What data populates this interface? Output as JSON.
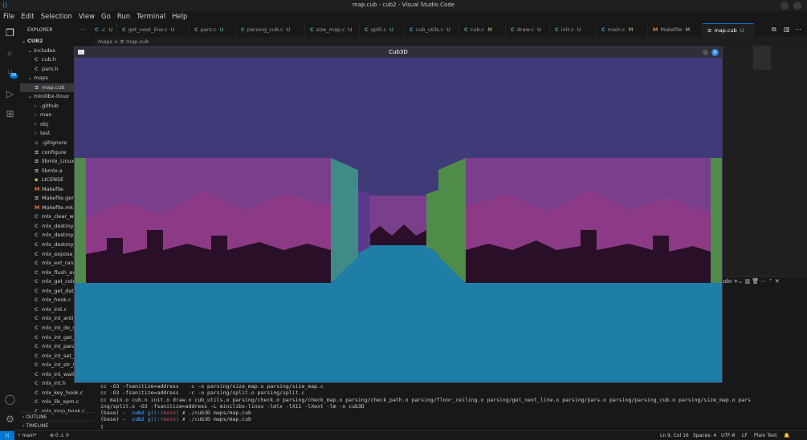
{
  "window": {
    "title": "map.cub - cub2 - Visual Studio Code"
  },
  "menu": [
    "File",
    "Edit",
    "Selection",
    "View",
    "Go",
    "Run",
    "Terminal",
    "Help"
  ],
  "activity_bar": {
    "scm_badge": "30"
  },
  "explorer": {
    "header": "EXPLORER",
    "more": "···",
    "root": "CUB2",
    "tree": [
      {
        "label": "includes",
        "type": "folder",
        "open": true,
        "depth": 1
      },
      {
        "label": "cub.h",
        "type": "c",
        "depth": 2
      },
      {
        "label": "pars.h",
        "type": "c",
        "depth": 2
      },
      {
        "label": "maps",
        "type": "folder",
        "open": true,
        "depth": 1
      },
      {
        "label": "map.cub",
        "type": "file",
        "depth": 2,
        "selected": true
      },
      {
        "label": "minilibx-linux",
        "type": "folder",
        "open": true,
        "depth": 1
      },
      {
        "label": ".github",
        "type": "folder",
        "open": false,
        "depth": 2
      },
      {
        "label": "man",
        "type": "folder",
        "open": false,
        "depth": 2
      },
      {
        "label": "obj",
        "type": "folder",
        "open": false,
        "depth": 2
      },
      {
        "label": "test",
        "type": "folder",
        "open": false,
        "depth": 2
      },
      {
        "label": ".gitignore",
        "type": "git",
        "depth": 2
      },
      {
        "label": "configure",
        "type": "file",
        "depth": 2
      },
      {
        "label": "libmlx_Linux.a",
        "type": "file",
        "depth": 2
      },
      {
        "label": "libmlx.a",
        "type": "file",
        "depth": 2
      },
      {
        "label": "LICENSE",
        "type": "license",
        "depth": 2
      },
      {
        "label": "Makefile",
        "type": "make",
        "depth": 2
      },
      {
        "label": "Makefile.gen",
        "type": "file",
        "depth": 2
      },
      {
        "label": "Makefile.mk",
        "type": "make",
        "depth": 2
      },
      {
        "label": "mlx_clear_win",
        "type": "c",
        "depth": 2
      },
      {
        "label": "mlx_destroy_c",
        "type": "c",
        "depth": 2
      },
      {
        "label": "mlx_destroy_i",
        "type": "c",
        "depth": 2
      },
      {
        "label": "mlx_destroy_v",
        "type": "c",
        "depth": 2
      },
      {
        "label": "mlx_expose_h",
        "type": "c",
        "depth": 2
      },
      {
        "label": "mlx_ext_randr",
        "type": "c",
        "depth": 2
      },
      {
        "label": "mlx_flush_eve",
        "type": "c",
        "depth": 2
      },
      {
        "label": "mlx_get_color",
        "type": "c",
        "depth": 2
      },
      {
        "label": "mlx_get_data_",
        "type": "c",
        "depth": 2
      },
      {
        "label": "mlx_hook.c",
        "type": "c",
        "depth": 2
      },
      {
        "label": "mlx_init.c",
        "type": "c",
        "depth": 2
      },
      {
        "label": "mlx_int_anti_r",
        "type": "c",
        "depth": 2
      },
      {
        "label": "mlx_int_do_nc",
        "type": "c",
        "depth": 2
      },
      {
        "label": "mlx_int_get_vi",
        "type": "c",
        "depth": 2
      },
      {
        "label": "mlx_int_param",
        "type": "c",
        "depth": 2
      },
      {
        "label": "mlx_int_set_w",
        "type": "c",
        "depth": 2
      },
      {
        "label": "mlx_int_str_to",
        "type": "c",
        "depth": 2
      },
      {
        "label": "mlx_int_wait_f",
        "type": "c",
        "depth": 2
      },
      {
        "label": "mlx_int.h",
        "type": "c",
        "depth": 2
      },
      {
        "label": "mlx_key_hook.c",
        "type": "c",
        "depth": 2
      },
      {
        "label": "mlx_lib_xpm.c",
        "type": "c",
        "depth": 2
      },
      {
        "label": "mlx_loop_hook.c",
        "type": "c",
        "depth": 2
      }
    ],
    "outline": "OUTLINE",
    "timeline": "TIMELINE"
  },
  "tabs": [
    {
      "label": ".c",
      "status": "U"
    },
    {
      "label": "get_next_line.c",
      "status": "U"
    },
    {
      "label": "pars.c",
      "status": "U"
    },
    {
      "label": "parsing_cub.c",
      "status": "U"
    },
    {
      "label": "size_map.c",
      "status": "U"
    },
    {
      "label": "split.c",
      "status": "U"
    },
    {
      "label": "cub_utils.c",
      "status": "U"
    },
    {
      "label": "cub.c",
      "status": "M"
    },
    {
      "label": "draw.c",
      "status": "U"
    },
    {
      "label": "init.c",
      "status": "U"
    },
    {
      "label": "main.c",
      "status": "M"
    },
    {
      "label": "Makefile",
      "status": "M",
      "make": true
    },
    {
      "label": "map.cub",
      "status": "U",
      "active": true
    }
  ],
  "breadcrumb": {
    "folder": "maps",
    "sep": ">",
    "file": "map.cub"
  },
  "game_window": {
    "title": "Cub3D",
    "close": "×"
  },
  "scene_colors": {
    "ceiling": "#3f3a78",
    "floor": "#1f7ea6",
    "sky": "#7a3f8c",
    "hills": "#8c3a86",
    "city": "#2a0f28",
    "wall_teal": "#3f8c86",
    "wall_green": "#4f8c4a"
  },
  "terminal": {
    "panel_label": "udo",
    "lines": [
      "cc -O3 -fsanitize=address   -c -o parsing/size_map.o parsing/size_map.c",
      "cc -O3 -fsanitize=address   -c -o parsing/split.o parsing/split.c",
      "cc main.o cub.o init.o draw.o cub_utils.o parsing/check.o parsing/check_map.o parsing/check_path.o parsing/floor_ceiling.o parsing/get_next_line.o parsing/pars.o parsing/parsing_cub.o parsing/size_map.o pars",
      "ing/split.o -O3 -fsanitize=address -L minilibx-linux -lmlx -lX11 -lXext -lm -o cub3D"
    ],
    "prompt": {
      "env": "(base)",
      "arrow": "→",
      "dir": "cub2",
      "git": "git:(",
      "branch": "main",
      "git_close": ")",
      "x": "✗"
    },
    "commands": [
      "./cub3D maps/map.cub",
      "./cub3D maps/map.cub"
    ],
    "cursor": "▯"
  },
  "statusbar": {
    "branch": "main*",
    "errors": "⊗ 0 ⚠ 0",
    "position": "Ln 9, Col 16",
    "spaces": "Spaces: 4",
    "encoding": "UTF-8",
    "eol": "LF",
    "language": "Plain Text",
    "bell": "🔔"
  }
}
